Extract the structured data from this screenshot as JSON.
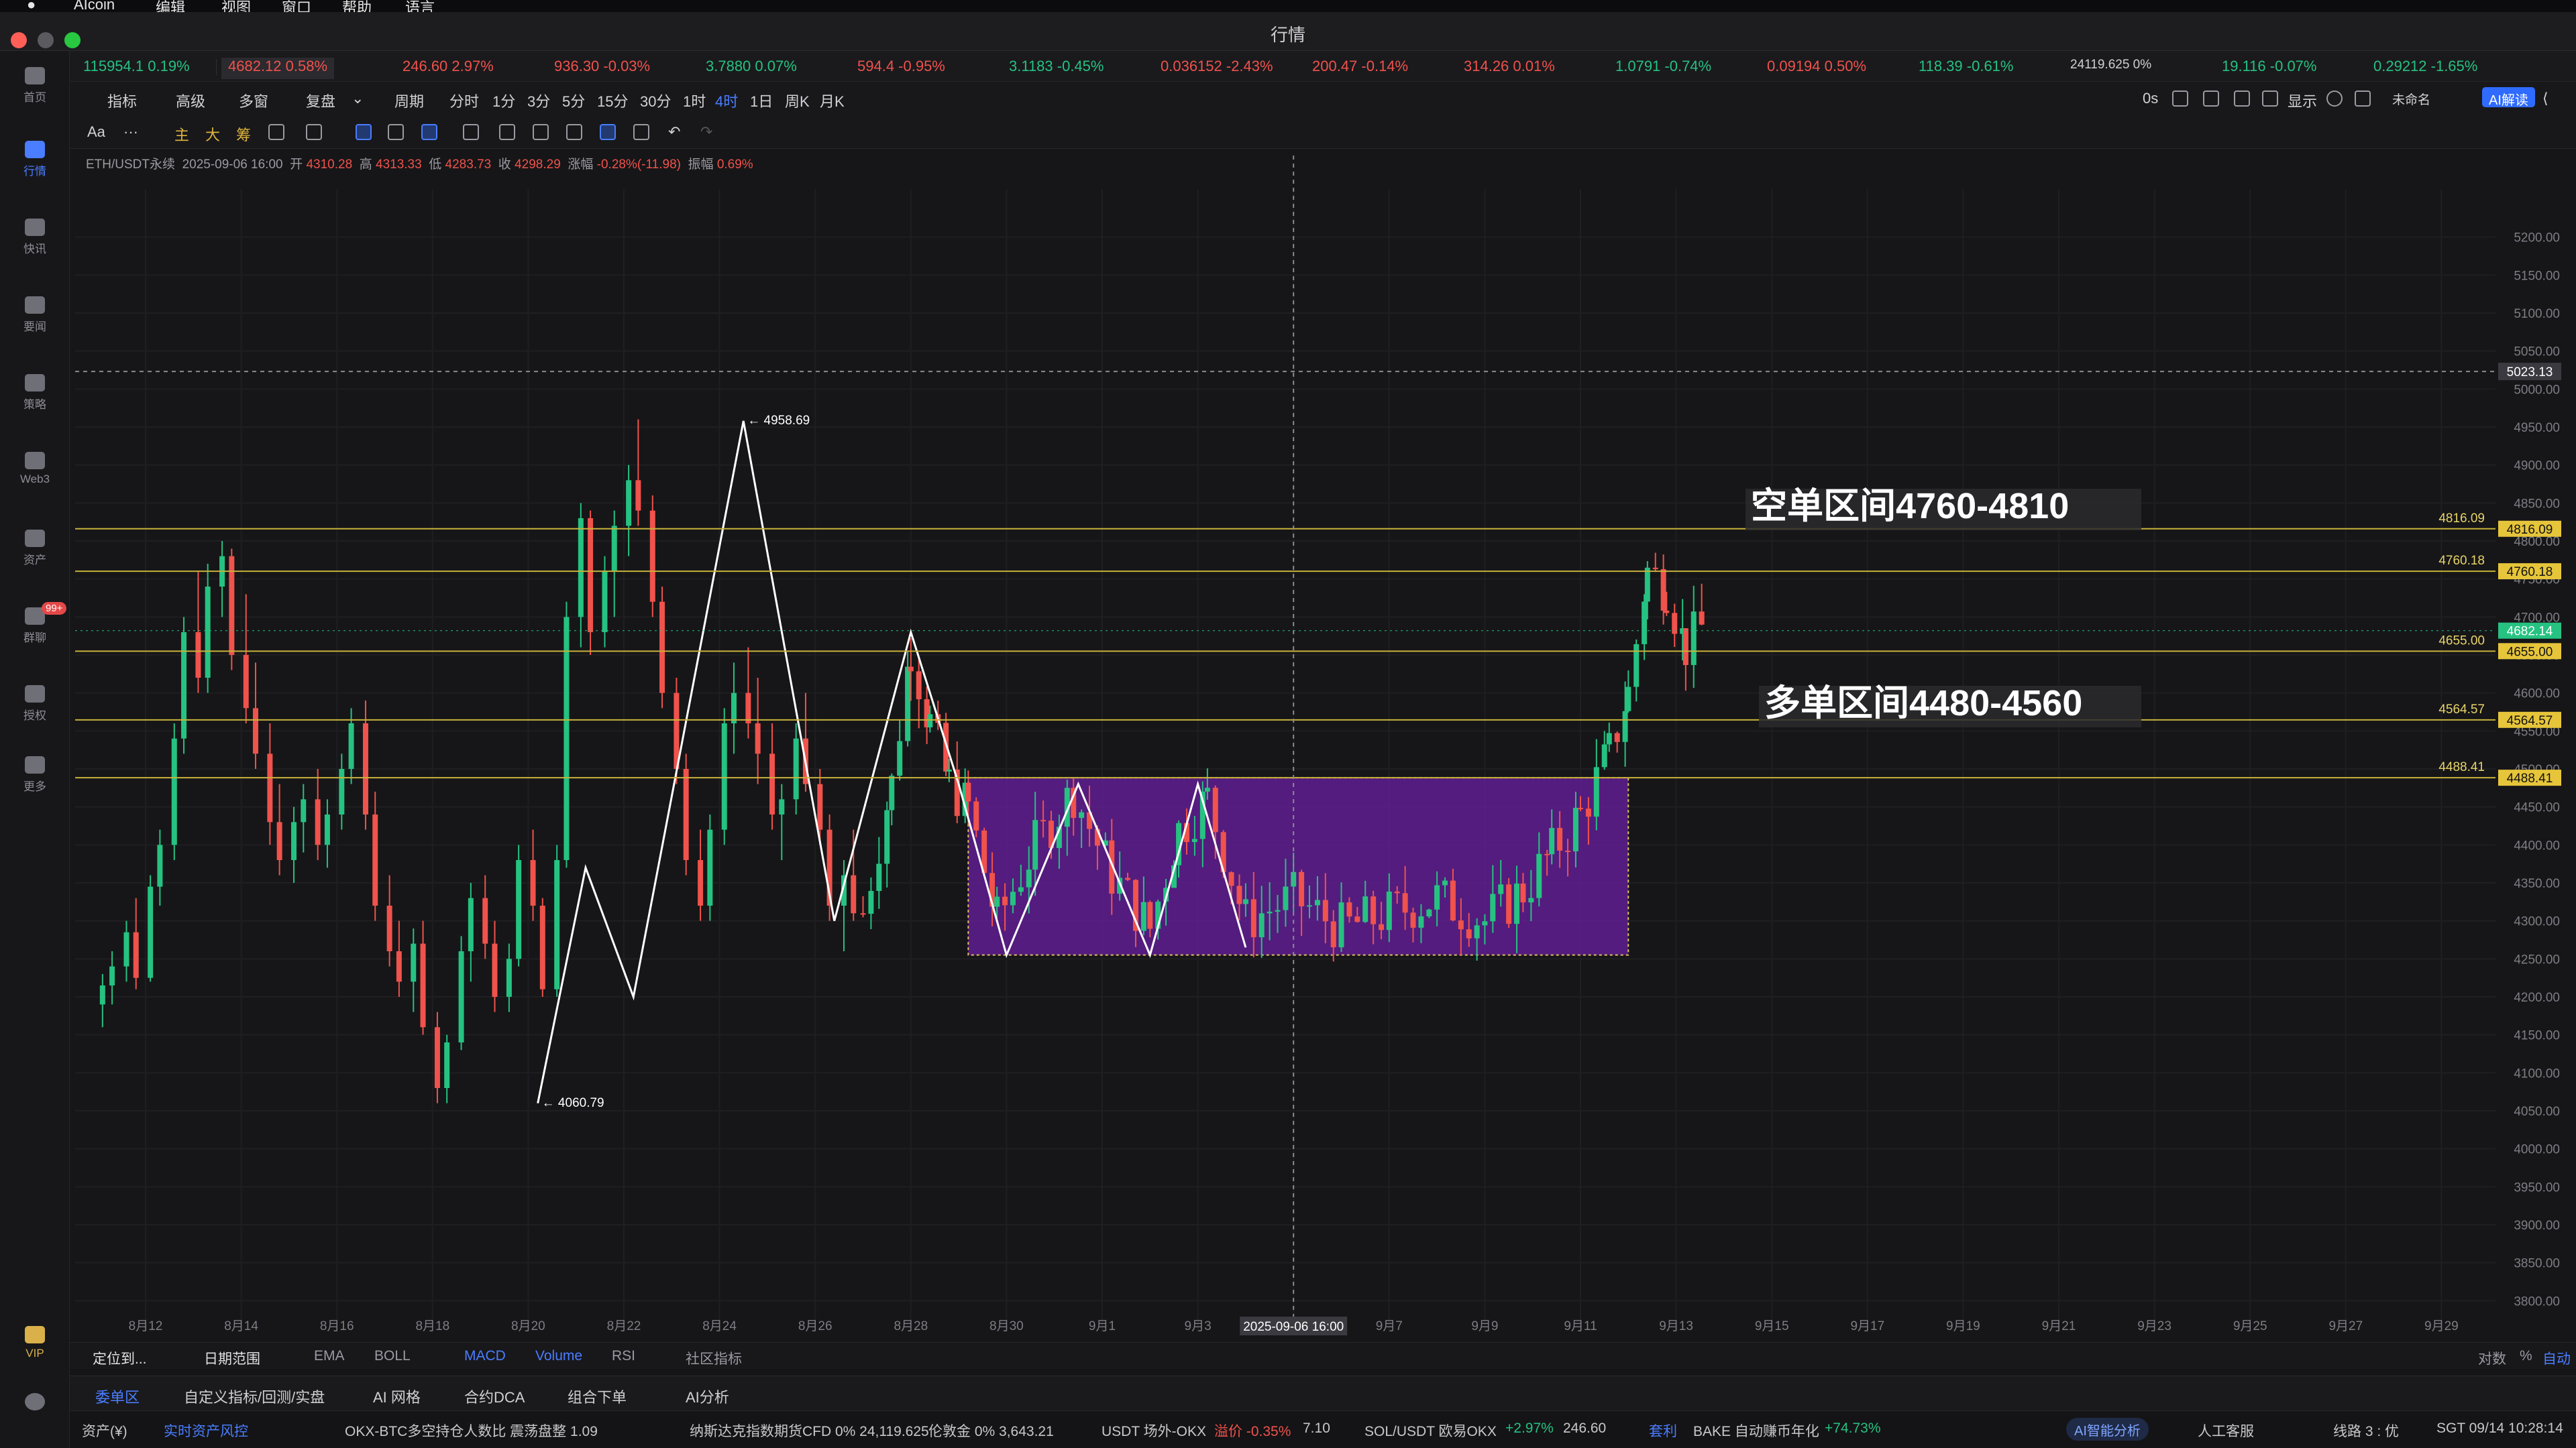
{
  "window": {
    "title": "行情"
  },
  "menubar": {
    "items": [
      "AIcoin",
      "编辑",
      "视图",
      "窗口",
      "帮助",
      "语言"
    ]
  },
  "sidebar": {
    "items": [
      {
        "label": "首页",
        "icon": "home-icon"
      },
      {
        "label": "行情",
        "icon": "market-icon",
        "active": true
      },
      {
        "label": "快讯",
        "icon": "news-flash-icon"
      },
      {
        "label": "要闻",
        "icon": "article-icon"
      },
      {
        "label": "策略",
        "icon": "strategy-icon"
      },
      {
        "label": "Web3",
        "icon": "web3-icon"
      },
      {
        "label": "资产",
        "icon": "wallet-icon"
      },
      {
        "label": "群聊",
        "icon": "chat-icon",
        "badge": "99+"
      },
      {
        "label": "授权",
        "icon": "auth-icon"
      },
      {
        "label": "更多",
        "icon": "more-icon"
      }
    ],
    "vip": "VIP"
  },
  "tickers": [
    {
      "text": "115954.1  0.19%",
      "dir": "up"
    },
    {
      "text": "4682.12  0.58%",
      "dir": "down",
      "active": true
    },
    {
      "text": "246.60  2.97%",
      "dir": "down"
    },
    {
      "text": "936.30  -0.03%",
      "dir": "down"
    },
    {
      "text": "3.7880  0.07%",
      "dir": "up"
    },
    {
      "text": "594.4  -0.95%",
      "dir": "down"
    },
    {
      "text": "3.1183  -0.45%",
      "dir": "up"
    },
    {
      "text": "0.036152  -2.43%",
      "dir": "down"
    },
    {
      "text": "200.47  -0.14%",
      "dir": "down"
    },
    {
      "text": "314.26  0.01%",
      "dir": "down"
    },
    {
      "text": "1.0791  -0.74%",
      "dir": "up"
    },
    {
      "text": "0.09194  0.50%",
      "dir": "down"
    },
    {
      "text": "118.39  -0.61%",
      "dir": "up"
    },
    {
      "text": "24119.625  0%",
      "dir": "neutral"
    },
    {
      "text": "19.116  -0.07%",
      "dir": "up"
    },
    {
      "text": "0.29212  -1.65%",
      "dir": "up"
    }
  ],
  "toolbar1": {
    "items": [
      "指标",
      "高级",
      "多窗",
      "复盘",
      "周期",
      "分时",
      "1分",
      "3分",
      "5分",
      "15分",
      "30分",
      "1时",
      "4时",
      "1日",
      "周K",
      "月K"
    ],
    "selected": "4时",
    "right": {
      "countdown": "0s",
      "display": "显示",
      "layout": "未命名",
      "ai": "AI解读"
    }
  },
  "toolbar2": {
    "font": "Aa",
    "more": "···",
    "marks": [
      "主",
      "大",
      "筹"
    ]
  },
  "ohlc": {
    "symbol": "ETH/USDT永续",
    "time": "2025-09-06 16:00",
    "open_label": "开",
    "open": "4310.28",
    "high_label": "高",
    "high": "4313.33",
    "low_label": "低",
    "low": "4283.73",
    "close_label": "收",
    "close": "4298.29",
    "change_label": "涨幅",
    "change": "-0.28%(-11.98)",
    "amp_label": "振幅",
    "amp": "0.69%"
  },
  "indicators": {
    "locate": "定位到...",
    "range": "日期范围",
    "items": [
      "EMA",
      "BOLL",
      "MACD",
      "Volume",
      "RSI",
      "社区指标"
    ],
    "on": [
      "MACD",
      "Volume"
    ],
    "right": [
      "对数",
      "%",
      "自动"
    ]
  },
  "tabs": {
    "items": [
      "委单区",
      "自定义指标/回测/实盘",
      "AI 网格",
      "合约DCA",
      "组合下单",
      "AI分析"
    ],
    "active": "委单区"
  },
  "statusbar": {
    "assets": "资产(¥)",
    "risk": "实时资产风控",
    "okx_ratio": "OKX-BTC多空持仓人数比  震荡盘整  1.09",
    "nasdaq": "纳斯达克指数期货CFD  0%  24,119.625",
    "gold": "伦敦金  0%  3,643.21",
    "usdt": "USDT 场外-OKX",
    "usdt_prem": "溢价 -0.35%",
    "usdt_val": "7.10",
    "sol": "SOL/USDT 欧易OKX",
    "sol_chg": "+2.97%",
    "sol_val": "246.60",
    "arb": "套利",
    "bake": "BAKE 自动赚币年化",
    "bake_val": "+74.73%",
    "ai_pill": "AI智能分析",
    "service": "人工客服",
    "line": "线路 3 : 优",
    "clock": "SGT 09/14 10:28:14"
  },
  "chart_data": {
    "type": "candlestick",
    "symbol": "ETH/USDT永续",
    "interval": "4时",
    "ylim": [
      3750,
      5250
    ],
    "y_ticks": [
      3800,
      3850,
      3900,
      3950,
      4000,
      4050,
      4100,
      4150,
      4200,
      4250,
      4300,
      4350,
      4400,
      4450,
      4500,
      4550,
      4600,
      4650,
      4700,
      4750,
      4800,
      4850,
      4900,
      4950,
      5000,
      5050,
      5100,
      5150,
      5200
    ],
    "x_ticks": [
      "8月12",
      "8月14",
      "8月16",
      "8月18",
      "8月20",
      "8月22",
      "8月24",
      "8月26",
      "8月28",
      "8月30",
      "9月1",
      "9月3",
      "9月5",
      "9月7",
      "9月9",
      "9月11",
      "9月13",
      "9月15",
      "9月17",
      "9月19",
      "9月21",
      "9月23",
      "9月25",
      "9月27",
      "9月29"
    ],
    "crosshair": {
      "x_label": "2025-09-06 16:00",
      "y_label": "5023.13",
      "y": 5023.13
    },
    "level_lines": [
      {
        "value": 4816.09,
        "label": "4816.09"
      },
      {
        "value": 4760.18,
        "label": "4760.18"
      },
      {
        "value": 4655.0,
        "label": "4655.00"
      },
      {
        "value": 4564.57,
        "label": "4564.57"
      },
      {
        "value": 4488.41,
        "label": "4488.41"
      }
    ],
    "last_price": "4682.14",
    "annotations": [
      {
        "text": "空单区间4760-4810",
        "at_price": 4760
      },
      {
        "text": "多单区间4480-4560",
        "at_price": 4560
      }
    ],
    "extremes": [
      {
        "text": "← 4958.69",
        "price": 4958.69,
        "day": 24.5
      },
      {
        "text": "← 4060.79",
        "price": 4060.79,
        "day": 20.2
      }
    ],
    "box": {
      "day_from": 29.2,
      "day_to": 43.0,
      "high": 4488.41,
      "low": 4255
    },
    "zigzag": [
      [
        20.2,
        4060
      ],
      [
        21.2,
        4370
      ],
      [
        22.2,
        4200
      ],
      [
        24.5,
        4958
      ],
      [
        26.4,
        4300
      ],
      [
        28.0,
        4680
      ],
      [
        29.0,
        4480
      ],
      [
        30.0,
        4255
      ],
      [
        31.5,
        4480
      ],
      [
        33.0,
        4255
      ],
      [
        34.0,
        4480
      ],
      [
        35.0,
        4265
      ]
    ],
    "candles": [
      [
        11.1,
        4190,
        4230,
        4160,
        4215
      ],
      [
        11.3,
        4215,
        4260,
        4190,
        4240
      ],
      [
        11.6,
        4240,
        4300,
        4220,
        4285
      ],
      [
        11.8,
        4285,
        4330,
        4210,
        4225
      ],
      [
        12.1,
        4225,
        4360,
        4220,
        4345
      ],
      [
        12.3,
        4345,
        4420,
        4320,
        4400
      ],
      [
        12.6,
        4400,
        4560,
        4380,
        4540
      ],
      [
        12.8,
        4540,
        4700,
        4520,
        4680
      ],
      [
        13.1,
        4680,
        4760,
        4600,
        4620
      ],
      [
        13.3,
        4620,
        4770,
        4600,
        4740
      ],
      [
        13.6,
        4740,
        4800,
        4700,
        4780
      ],
      [
        13.8,
        4780,
        4790,
        4630,
        4650
      ],
      [
        14.1,
        4650,
        4730,
        4560,
        4580
      ],
      [
        14.3,
        4580,
        4640,
        4500,
        4520
      ],
      [
        14.6,
        4520,
        4560,
        4400,
        4430
      ],
      [
        14.8,
        4430,
        4480,
        4360,
        4380
      ],
      [
        15.1,
        4380,
        4450,
        4350,
        4430
      ],
      [
        15.3,
        4430,
        4480,
        4390,
        4460
      ],
      [
        15.6,
        4460,
        4500,
        4380,
        4400
      ],
      [
        15.8,
        4400,
        4460,
        4370,
        4440
      ],
      [
        16.1,
        4440,
        4520,
        4420,
        4500
      ],
      [
        16.3,
        4500,
        4580,
        4480,
        4560
      ],
      [
        16.6,
        4560,
        4590,
        4420,
        4440
      ],
      [
        16.8,
        4440,
        4470,
        4300,
        4320
      ],
      [
        17.1,
        4320,
        4360,
        4240,
        4260
      ],
      [
        17.3,
        4260,
        4300,
        4200,
        4220
      ],
      [
        17.6,
        4220,
        4290,
        4180,
        4270
      ],
      [
        17.8,
        4270,
        4300,
        4150,
        4160
      ],
      [
        18.1,
        4160,
        4180,
        4060,
        4080
      ],
      [
        18.3,
        4080,
        4150,
        4060,
        4140
      ],
      [
        18.6,
        4140,
        4280,
        4130,
        4260
      ],
      [
        18.8,
        4260,
        4350,
        4220,
        4330
      ],
      [
        19.1,
        4330,
        4360,
        4250,
        4270
      ],
      [
        19.3,
        4270,
        4300,
        4180,
        4200
      ],
      [
        19.6,
        4200,
        4270,
        4180,
        4250
      ],
      [
        19.8,
        4250,
        4400,
        4240,
        4380
      ],
      [
        20.1,
        4380,
        4420,
        4300,
        4320
      ],
      [
        20.3,
        4320,
        4330,
        4200,
        4210
      ],
      [
        20.6,
        4210,
        4400,
        4200,
        4380
      ],
      [
        20.8,
        4380,
        4720,
        4370,
        4700
      ],
      [
        21.1,
        4700,
        4850,
        4660,
        4830
      ],
      [
        21.3,
        4830,
        4840,
        4650,
        4680
      ],
      [
        21.6,
        4680,
        4780,
        4660,
        4760
      ],
      [
        21.8,
        4760,
        4840,
        4700,
        4820
      ],
      [
        22.1,
        4820,
        4900,
        4780,
        4880
      ],
      [
        22.3,
        4880,
        4960,
        4820,
        4840
      ],
      [
        22.6,
        4840,
        4860,
        4700,
        4720
      ],
      [
        22.8,
        4720,
        4740,
        4580,
        4600
      ],
      [
        23.1,
        4600,
        4620,
        4480,
        4500
      ],
      [
        23.3,
        4500,
        4520,
        4360,
        4380
      ],
      [
        23.6,
        4380,
        4420,
        4300,
        4320
      ],
      [
        23.8,
        4320,
        4440,
        4300,
        4420
      ],
      [
        24.1,
        4420,
        4580,
        4400,
        4560
      ],
      [
        24.3,
        4560,
        4640,
        4520,
        4600
      ],
      [
        24.6,
        4600,
        4660,
        4540,
        4560
      ],
      [
        24.8,
        4560,
        4620,
        4480,
        4520
      ],
      [
        25.1,
        4520,
        4560,
        4420,
        4440
      ],
      [
        25.3,
        4440,
        4480,
        4380,
        4460
      ],
      [
        25.6,
        4460,
        4560,
        4440,
        4540
      ],
      [
        25.8,
        4540,
        4600,
        4470,
        4480
      ],
      [
        26.1,
        4480,
        4500,
        4400,
        4420
      ],
      [
        26.3,
        4420,
        4440,
        4300,
        4320
      ],
      [
        26.6,
        4320,
        4380,
        4260,
        4360
      ],
      [
        26.8,
        4360,
        4420,
        4300,
        4310
      ]
    ]
  }
}
